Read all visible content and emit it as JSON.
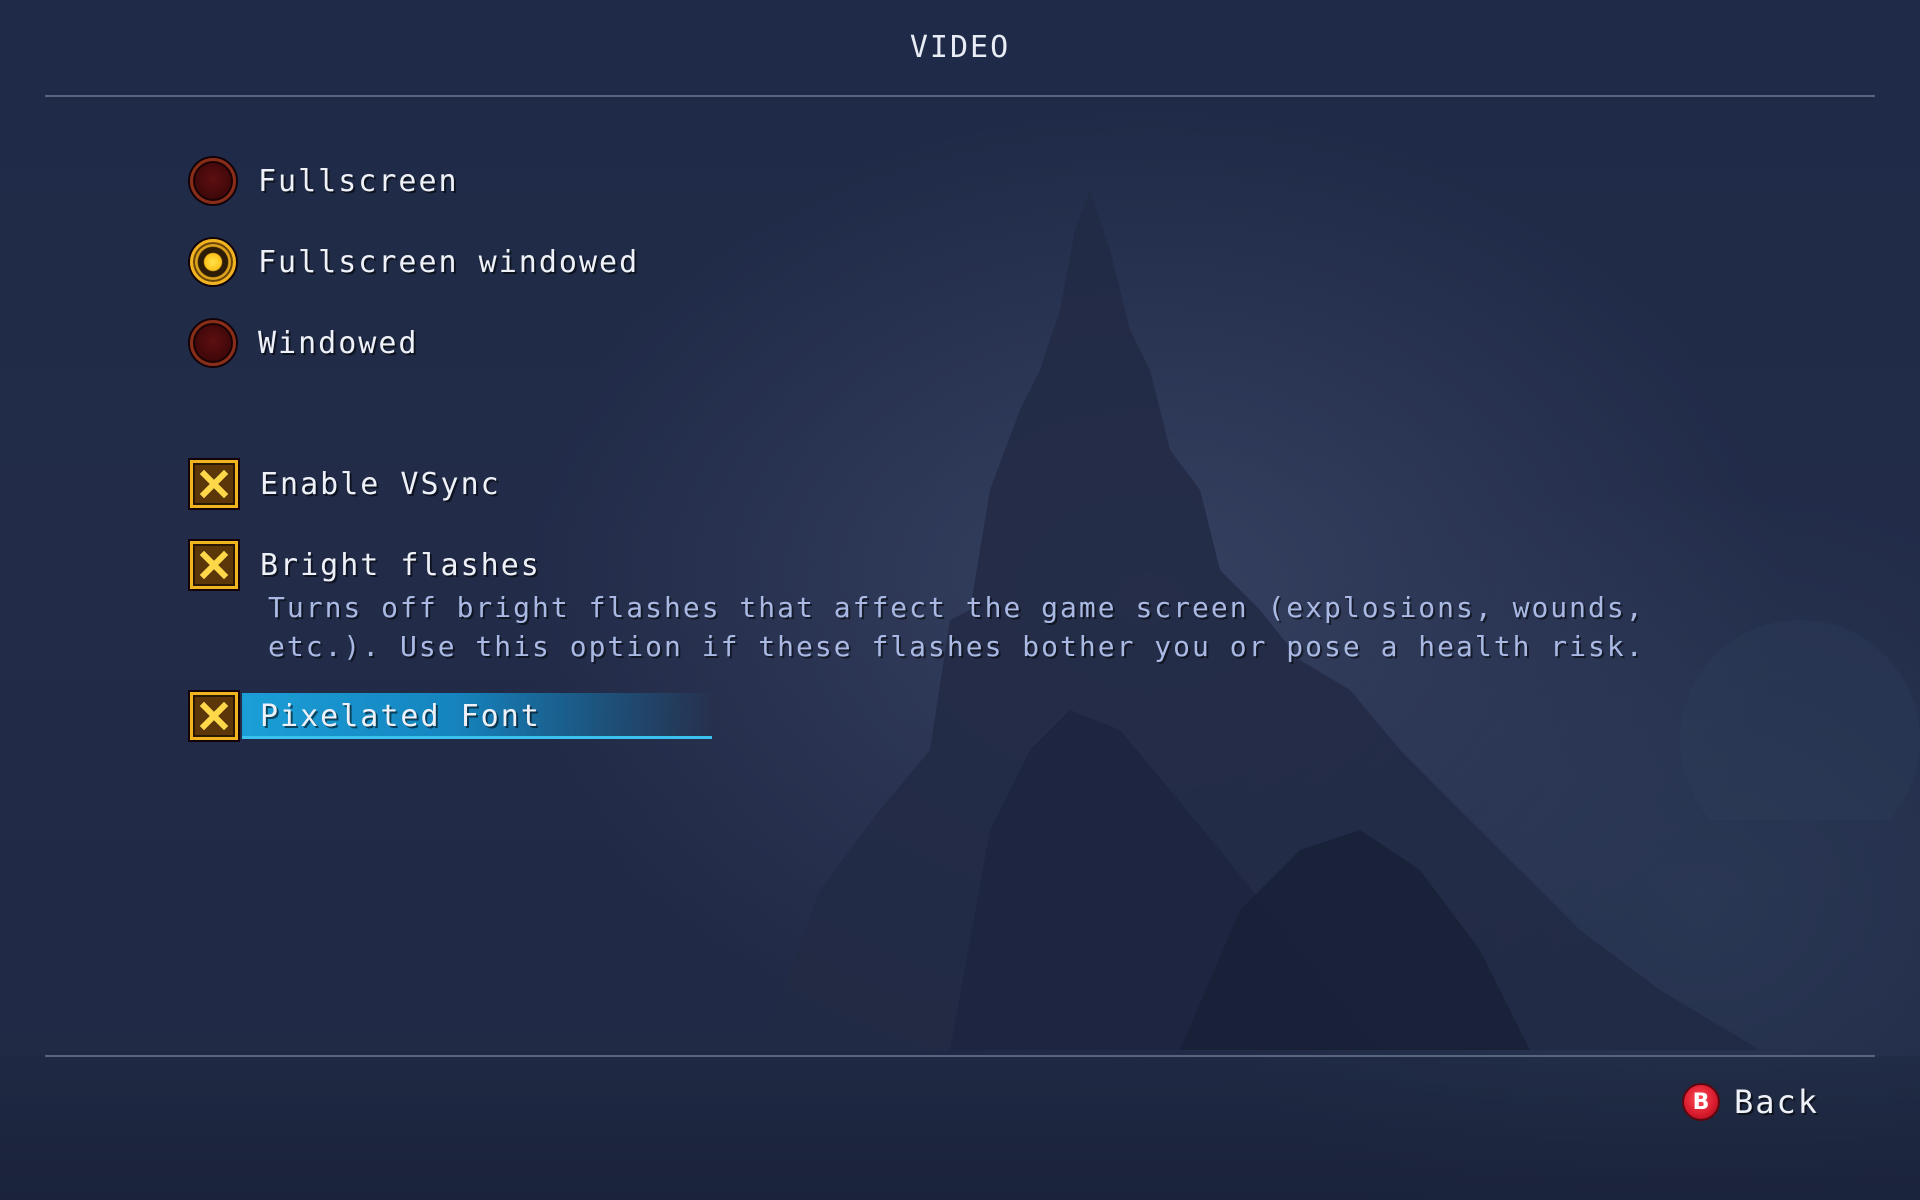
{
  "header": {
    "title": "VIDEO"
  },
  "display_mode": {
    "options": [
      {
        "label": "Fullscreen",
        "selected": false
      },
      {
        "label": "Fullscreen windowed",
        "selected": true
      },
      {
        "label": "Windowed",
        "selected": false
      }
    ]
  },
  "toggles": [
    {
      "label": "Enable VSync",
      "checked": true
    },
    {
      "label": "Bright flashes",
      "checked": true,
      "description": "Turns off bright flashes that affect the game screen (explosions, wounds, etc.). Use this option if these flashes bother you or pose a health risk."
    },
    {
      "label": "Pixelated Font",
      "checked": true,
      "focused": true
    }
  ],
  "footer": {
    "back_button_glyph": "B",
    "back_label": "Back"
  },
  "colors": {
    "focus_highlight": "#1b9ed6",
    "checkbox_gold": "#f0b41f",
    "radio_selected": "#ffc21a",
    "radio_unselected": "#5e0f10",
    "description_text": "#a9b9e3"
  },
  "icons": {
    "radio_unselected": "radio-empty-icon",
    "radio_selected": "radio-filled-icon",
    "checkbox_checked": "checkbox-x-icon",
    "back_button": "b-button-icon"
  }
}
